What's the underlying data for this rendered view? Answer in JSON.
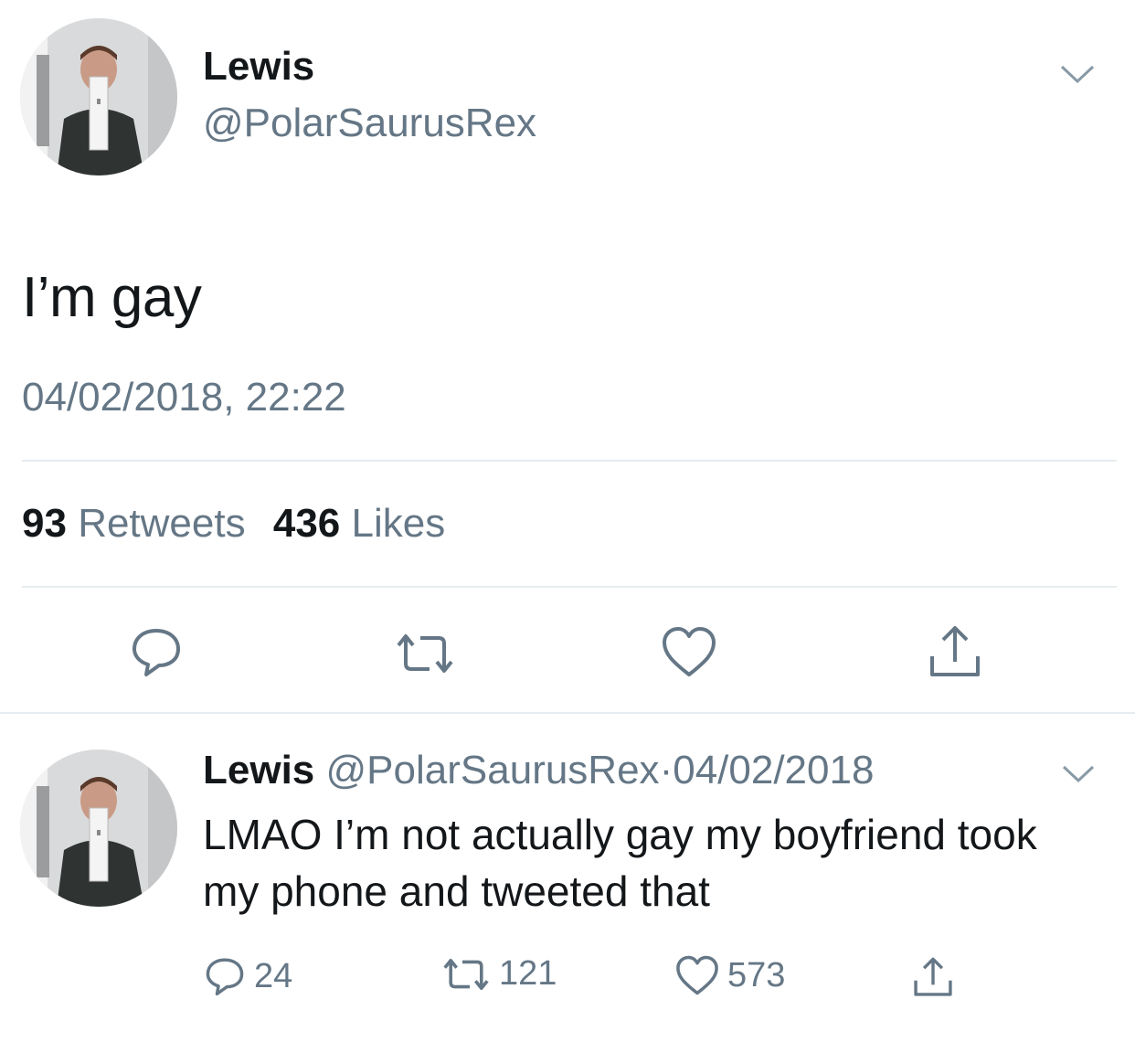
{
  "tweet": {
    "author_name": "Lewis",
    "author_handle": "@PolarSaurusRex",
    "text": "I’m gay",
    "timestamp": "04/02/2018, 22:22",
    "retweet_count": "93",
    "retweet_label": "Retweets",
    "like_count": "436",
    "like_label": "Likes"
  },
  "reply": {
    "author_name": "Lewis",
    "author_handle": "@PolarSaurusRex",
    "separator": "·",
    "date": "04/02/2018",
    "text": "LMAO I’m not actually gay my boyfriend took my phone and tweeted that",
    "reply_count": "24",
    "retweet_count": "121",
    "like_count": "573"
  },
  "icons": {
    "reply": "reply-icon",
    "retweet": "retweet-icon",
    "like": "heart-icon",
    "share": "share-icon",
    "menu": "chevron-down-icon"
  },
  "colors": {
    "text": "#14171a",
    "secondary": "#657786",
    "divider": "#e6ecf0"
  }
}
